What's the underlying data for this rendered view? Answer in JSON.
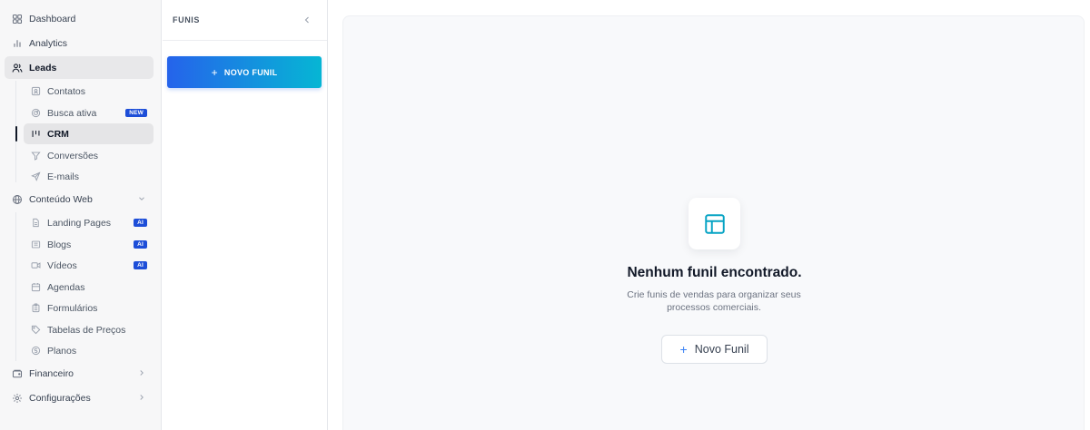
{
  "sidebar": {
    "dashboard": "Dashboard",
    "analytics": "Analytics",
    "leads": "Leads",
    "contatos": "Contatos",
    "busca_ativa": "Busca ativa",
    "busca_ativa_badge": "NEW",
    "crm": "CRM",
    "conversoes": "Conversões",
    "emails": "E-mails",
    "conteudo_web": "Conteúdo Web",
    "landing_pages": "Landing Pages",
    "blogs": "Blogs",
    "videos": "Vídeos",
    "ai_badge": "AI",
    "agendas": "Agendas",
    "formularios": "Formulários",
    "tabelas_precos": "Tabelas de Preços",
    "planos": "Planos",
    "financeiro": "Financeiro",
    "configuracoes": "Configurações"
  },
  "funis": {
    "title": "FUNIS",
    "new_button": "NOVO FUNIL"
  },
  "main": {
    "empty_title": "Nenhum funil encontrado.",
    "empty_description": "Crie funis de vendas para organizar seus processos comerciais.",
    "empty_button": "Novo Funil"
  },
  "colors": {
    "accent": "#2563eb",
    "accent_end": "#06b6d4",
    "badge": "#1d4ed8",
    "icon_teal": "#06a3c4"
  }
}
